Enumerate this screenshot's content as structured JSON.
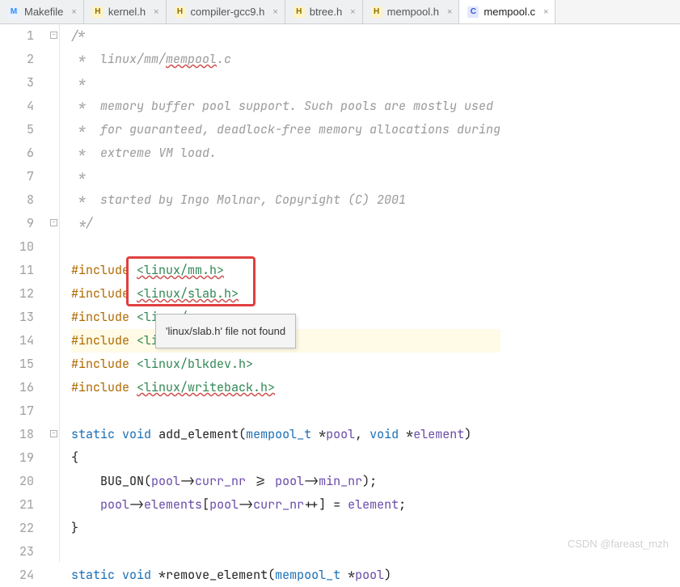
{
  "tabs": [
    {
      "label": "Makefile",
      "icon": "M",
      "iconClass": "ico-m",
      "active": false
    },
    {
      "label": "kernel.h",
      "icon": "H",
      "iconClass": "ico-h",
      "active": false
    },
    {
      "label": "compiler-gcc9.h",
      "icon": "H",
      "iconClass": "ico-h",
      "active": false
    },
    {
      "label": "btree.h",
      "icon": "H",
      "iconClass": "ico-h",
      "active": false
    },
    {
      "label": "mempool.h",
      "icon": "H",
      "iconClass": "ico-h",
      "active": false
    },
    {
      "label": "mempool.c",
      "icon": "C",
      "iconClass": "ico-c",
      "active": true
    }
  ],
  "tooltip": {
    "text": "'linux/slab.h' file not found"
  },
  "highlight_line": 14,
  "redbox_lines": [
    11,
    12
  ],
  "watermark": "CSDN @fareast_mzh",
  "lines": [
    {
      "n": 1,
      "html": "<span class=\"comment\">/*</span>"
    },
    {
      "n": 2,
      "html": "<span class=\"comment\"> *  linux/mm/<span class=\"err-underline\">mempool</span>.c</span>"
    },
    {
      "n": 3,
      "html": "<span class=\"comment\"> *</span>"
    },
    {
      "n": 4,
      "html": "<span class=\"comment\"> *  memory buffer pool support. Such pools are mostly used</span>"
    },
    {
      "n": 5,
      "html": "<span class=\"comment\"> *  for guaranteed, deadlock-free memory allocations during</span>"
    },
    {
      "n": 6,
      "html": "<span class=\"comment\"> *  extreme VM load.</span>"
    },
    {
      "n": 7,
      "html": "<span class=\"comment\"> *</span>"
    },
    {
      "n": 8,
      "html": "<span class=\"comment\"> *  started by Ingo Molnar, Copyright (C) 2001</span>"
    },
    {
      "n": 9,
      "html": "<span class=\"comment\"> */</span>"
    },
    {
      "n": 10,
      "html": ""
    },
    {
      "n": 11,
      "html": "<span class=\"macro\">#include</span> <span class=\"string err-underline\">&lt;linux/mm.h&gt;</span>"
    },
    {
      "n": 12,
      "html": "<span class=\"macro\">#include</span> <span class=\"string err-underline\">&lt;linux/slab.h&gt;</span>"
    },
    {
      "n": 13,
      "html": "<span class=\"macro\">#include</span> <span class=\"string\">&lt;linux/exp</span>"
    },
    {
      "n": 14,
      "html": "<span class=\"macro\">#include</span> <span class=\"string\">&lt;linux/mem</span>"
    },
    {
      "n": 15,
      "html": "<span class=\"macro\">#include</span> <span class=\"string\">&lt;linux/blkdev.h&gt;</span>"
    },
    {
      "n": 16,
      "html": "<span class=\"macro\">#include</span> <span class=\"string err-underline\">&lt;linux/writeback.h&gt;</span>"
    },
    {
      "n": 17,
      "html": ""
    },
    {
      "n": 18,
      "html": "<span class=\"keyword2\">static</span> <span class=\"keyword2\">void</span> <span class=\"func\">add_element</span>(<span class=\"type\">mempool_t</span> *<span class=\"ident\">pool</span>, <span class=\"keyword2\">void</span> *<span class=\"ident\">element</span>)"
    },
    {
      "n": 19,
      "html": "{"
    },
    {
      "n": 20,
      "html": "    BUG_ON(<span class=\"ident\">pool</span>-&gt;<span class=\"ident\">curr_nr</span> &gt;= <span class=\"ident\">pool</span>-&gt;<span class=\"ident\">min_nr</span>);"
    },
    {
      "n": 21,
      "html": "    <span class=\"ident\">pool</span>-&gt;<span class=\"ident\">elements</span>[<span class=\"ident\">pool</span>-&gt;<span class=\"ident\">curr_nr</span>++] = <span class=\"ident\">element</span>;"
    },
    {
      "n": 22,
      "html": "}"
    },
    {
      "n": 23,
      "html": ""
    },
    {
      "n": 24,
      "html": "<span class=\"keyword2\">static</span> <span class=\"keyword2\">void</span> *<span class=\"func\">remove_element</span>(<span class=\"type\">mempool_t</span> *<span class=\"ident\">pool</span>)"
    }
  ]
}
